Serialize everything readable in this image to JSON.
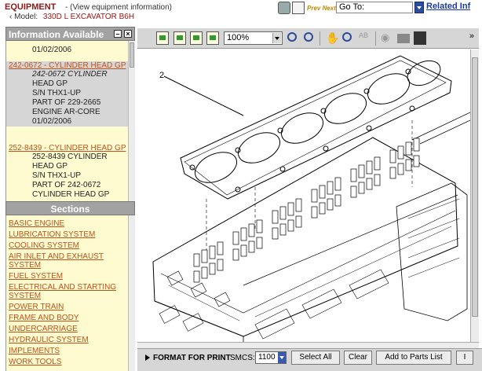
{
  "header": {
    "title": "EQUIPMENT",
    "view_link": "(View equipment information)",
    "model_label": "Model:",
    "model_value": "330D L EXCAVATOR B6H",
    "prev_next": "Prev Next",
    "goto_label": "Go To:",
    "related": "Related Inf"
  },
  "info_panel": {
    "title": "Information Available",
    "top_date": "01/02/2006",
    "items": [
      {
        "link": "242-0672 - CYLINDER HEAD GP",
        "details": [
          "242-0672 CYLINDER",
          "HEAD GP",
          "S/N THX1-UP",
          "PART OF 229-2665",
          "ENGINE AR-CORE",
          "01/02/2006"
        ]
      },
      {
        "link": "252-8439 - CYLINDER HEAD GP",
        "details": [
          "252-8439 CYLINDER",
          "HEAD GP",
          "S/N THX1-UP",
          "PART OF 242-0672",
          "CYLINDER HEAD GP"
        ]
      }
    ]
  },
  "sections_panel": {
    "title": "Sections",
    "items": [
      "BASIC ENGINE",
      "LUBRICATION SYSTEM",
      "COOLING SYSTEM",
      "AIR INLET AND EXHAUST SYSTEM",
      "FUEL SYSTEM",
      "ELECTRICAL AND STARTING SYSTEM",
      "POWER TRAIN",
      "FRAME AND BODY",
      "UNDERCARRIAGE",
      "HYDRAULIC SYSTEM",
      "IMPLEMENTS",
      "WORK TOOLS"
    ]
  },
  "toolbar": {
    "zoom": "100%",
    "icons": [
      "page-icon",
      "page-text-icon",
      "page-prev-icon",
      "page-next-icon",
      "zoom-in-icon",
      "zoom-out-icon",
      "pan-hand-icon",
      "zoom-area-icon",
      "text-select-icon",
      "find-icon",
      "print-icon",
      "save-icon"
    ]
  },
  "drawing": {
    "callout": "2"
  },
  "bottom_bar": {
    "format_print": "FORMAT FOR PRINT",
    "smcs_label": "SMCS:",
    "smcs_value": "1100",
    "select_all": "Select All",
    "clear": "Clear",
    "add_to_parts": "Add to Parts List",
    "more": "I"
  },
  "colors": {
    "panel_header": "#a2a2a2",
    "panel_bg": "#fffbd0",
    "link": "#c0521a",
    "title": "#8a1a1a"
  }
}
